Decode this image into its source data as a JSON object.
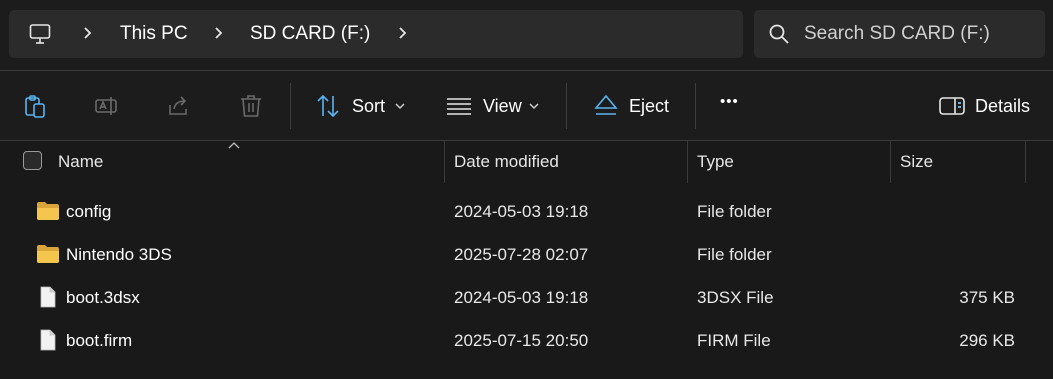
{
  "window": {
    "title": "SD CARD (F:)"
  },
  "address_bar": {
    "icon": "pc-icon",
    "crumbs": [
      "This PC",
      "SD CARD (F:)"
    ]
  },
  "search": {
    "placeholder": "Search SD CARD (F:)",
    "value": ""
  },
  "command_bar": {
    "icons": [
      "clipboard-icon",
      "rename-icon",
      "share-icon",
      "delete-icon"
    ],
    "sort_label": "Sort",
    "view_label": "View",
    "eject_label": "Eject",
    "more_label": "•••",
    "details_label": "Details"
  },
  "columns": {
    "name": "Name",
    "date": "Date modified",
    "type": "Type",
    "size": "Size"
  },
  "files": [
    {
      "name": "config",
      "date": "2024-05-03 19:18",
      "type": "File folder",
      "size": "",
      "icon": "folder-icon"
    },
    {
      "name": "Nintendo 3DS",
      "date": "2025-07-28 02:07",
      "type": "File folder",
      "size": "",
      "icon": "folder-icon"
    },
    {
      "name": "boot.3dsx",
      "date": "2024-05-03 19:18",
      "type": "3DSX File",
      "size": "375 KB",
      "icon": "file-icon"
    },
    {
      "name": "boot.firm",
      "date": "2025-07-15 20:50",
      "type": "FIRM File",
      "size": "296 KB",
      "icon": "file-icon"
    }
  ],
  "colors": {
    "background": "#191919",
    "bar_background": "#2b2b2b",
    "folder": "#f4c64e",
    "eject_accent": "#5ab4f0",
    "details_accent": "#8dcdf5"
  }
}
